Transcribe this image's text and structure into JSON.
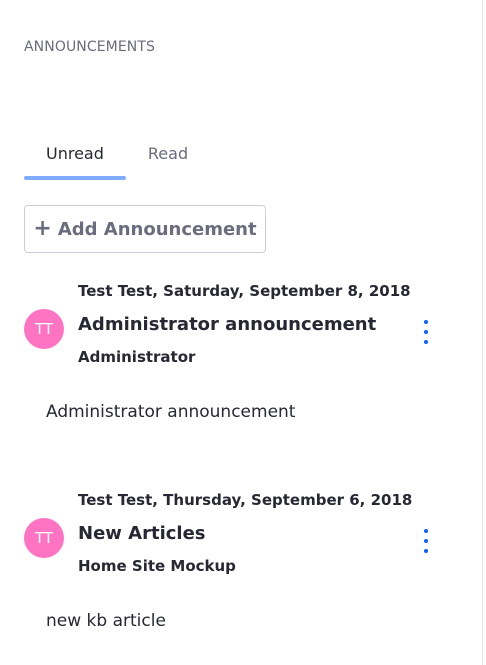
{
  "panel": {
    "title": "ANNOUNCEMENTS"
  },
  "tabs": [
    {
      "label": "Unread",
      "active": true
    },
    {
      "label": "Read",
      "active": false
    }
  ],
  "add_button": {
    "icon": "plus-icon",
    "label": "Add Announcement"
  },
  "announcements": [
    {
      "avatar": "TT",
      "meta": "Test Test, Saturday, September 8, 2018",
      "title": "Administrator announcement",
      "site": "Administrator",
      "body": "Administrator announcement"
    },
    {
      "avatar": "TT",
      "meta": "Test Test, Thursday, September 6, 2018",
      "title": "New Articles",
      "site": "Home Site Mockup",
      "body": "new kb article"
    }
  ],
  "colors": {
    "accent": "#80acff",
    "avatar": "#ff73c3",
    "kebab": "#0b5fff",
    "muted_text": "#6b6c7e",
    "text": "#272833"
  }
}
